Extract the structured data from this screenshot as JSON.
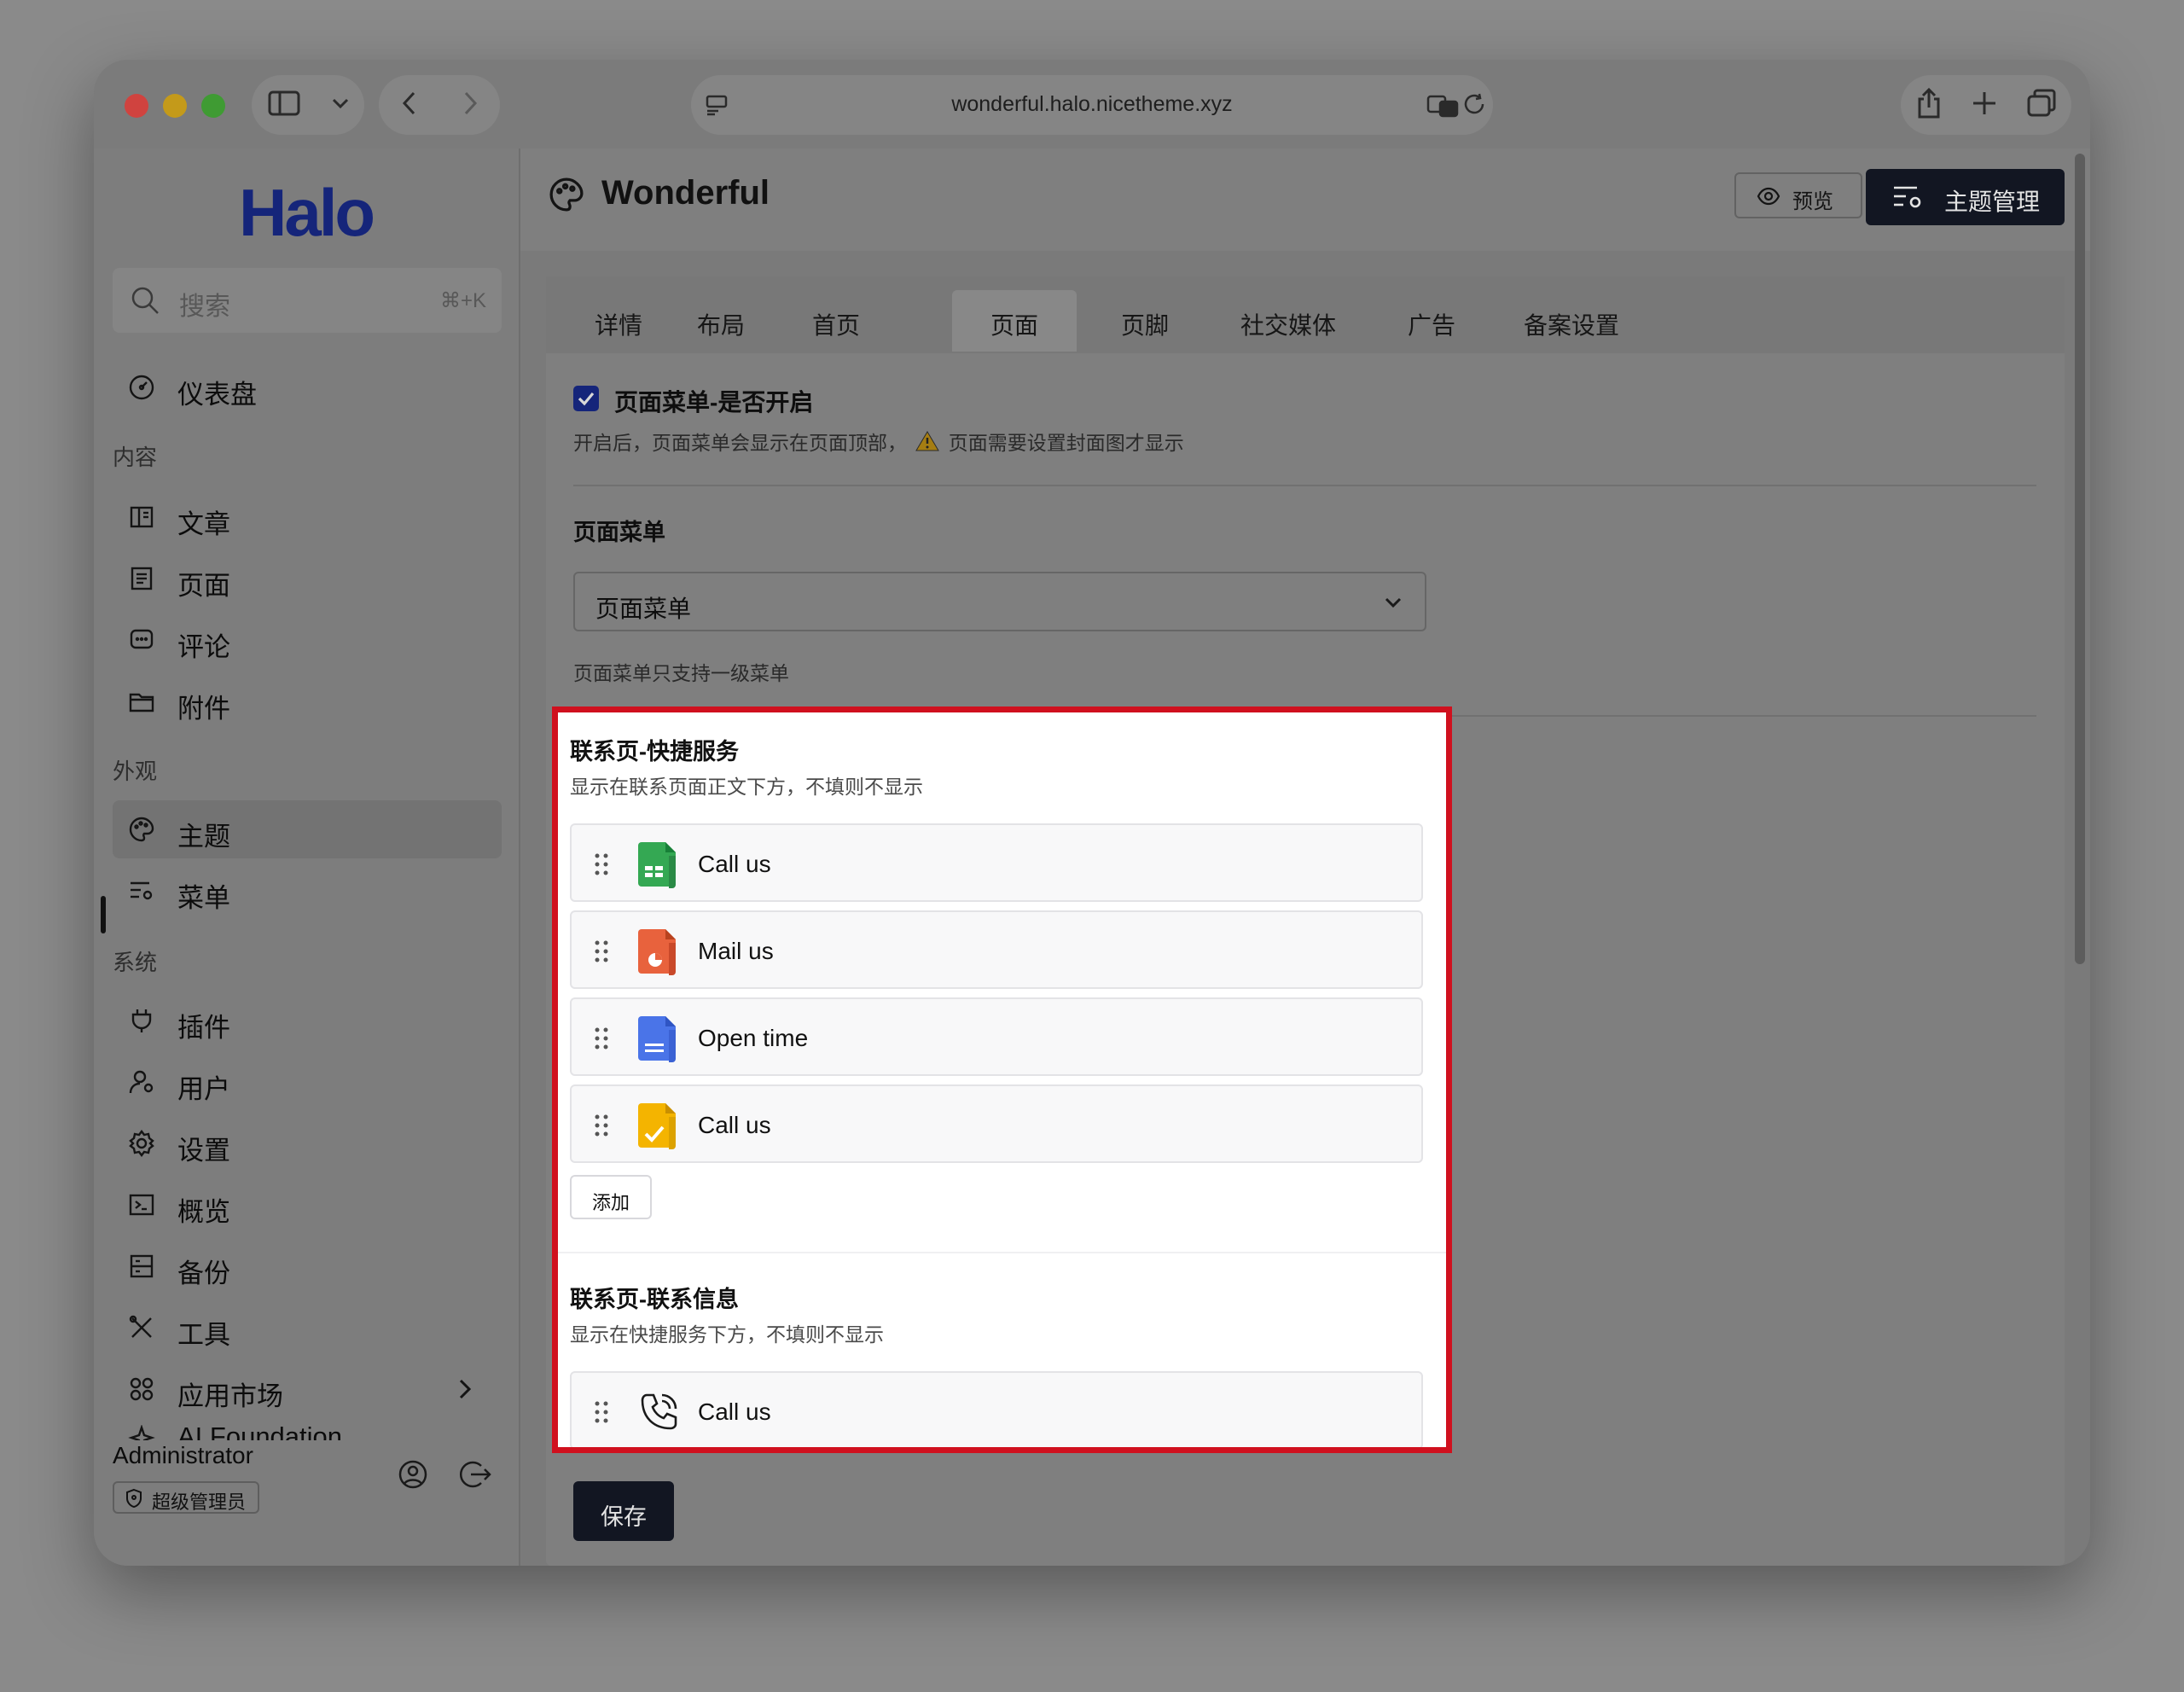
{
  "browser": {
    "url": "wonderful.halo.nicetheme.xyz"
  },
  "sidebar": {
    "logo": "Halo",
    "search_placeholder": "搜索",
    "search_shortcut": "⌘+K",
    "dashboard": "仪表盘",
    "groups": {
      "content": "内容",
      "appearance": "外观",
      "system": "系统"
    },
    "content_items": [
      "文章",
      "页面",
      "评论",
      "附件"
    ],
    "appearance_items": [
      "主题",
      "菜单"
    ],
    "system_items": [
      "插件",
      "用户",
      "设置",
      "概览",
      "备份",
      "工具",
      "应用市场",
      "AI Foundation"
    ],
    "user": {
      "name": "Administrator",
      "role": "超级管理员"
    }
  },
  "header": {
    "title": "Wonderful",
    "preview_label": "预览",
    "theme_manage_label": "主题管理"
  },
  "tabs": [
    "详情",
    "布局",
    "首页",
    "页面",
    "页脚",
    "社交媒体",
    "广告",
    "备案设置"
  ],
  "active_tab": "页面",
  "form": {
    "page_menu_toggle_label": "页面菜单-是否开启",
    "page_menu_toggle_help_a": "开启后，页面菜单会显示在页面顶部，",
    "page_menu_toggle_help_b": "页面需要设置封面图才显示",
    "page_menu_label": "页面菜单",
    "page_menu_value": "页面菜单",
    "page_menu_help": "页面菜单只支持一级菜单",
    "quick_service": {
      "title": "联系页-快捷服务",
      "help": "显示在联系页面正文下方，不填则不显示",
      "items": [
        "Call us",
        "Mail us",
        "Open time",
        "Call us"
      ],
      "add_label": "添加"
    },
    "contact_info": {
      "title": "联系页-联系信息",
      "help": "显示在快捷服务下方，不填则不显示",
      "items": [
        "Call us"
      ]
    },
    "save_label": "保存"
  },
  "colors": {
    "brand": "#15257a",
    "highlight_border": "#d0101e",
    "sheet_green": "#34a853",
    "slides_orange": "#e8623d",
    "docs_blue": "#4a74e8",
    "tasks_yellow": "#f4b400"
  }
}
